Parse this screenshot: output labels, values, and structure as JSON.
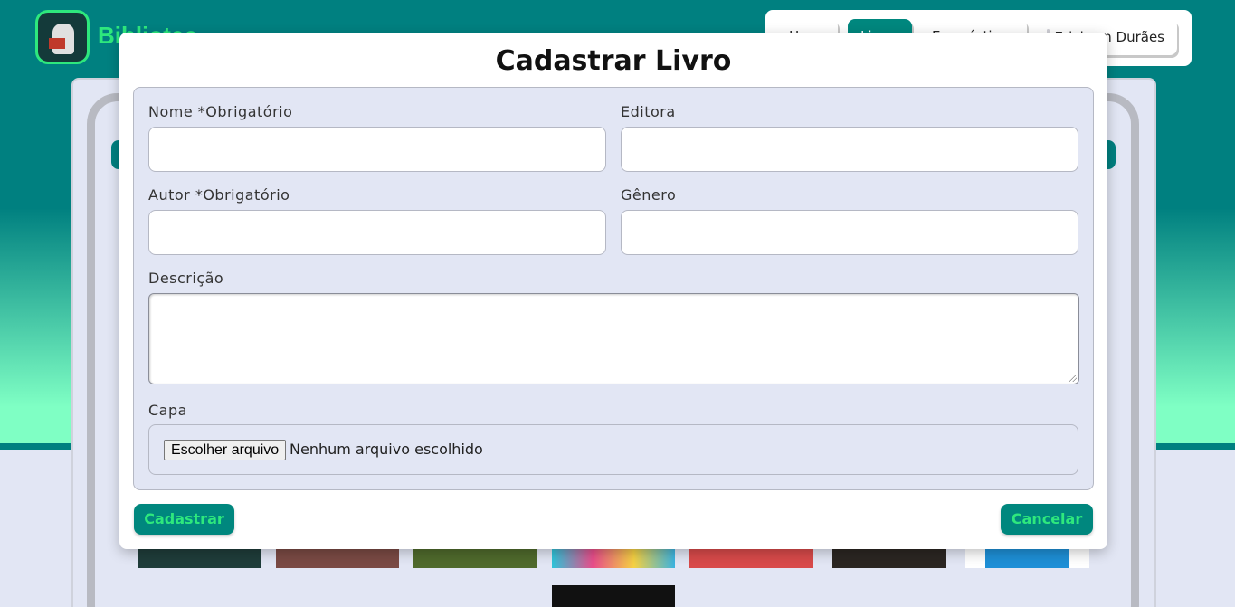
{
  "header": {
    "brand": "Bibliotec",
    "nav": [
      {
        "label": "Home"
      },
      {
        "label": "Livros"
      },
      {
        "label": "Empréstimos"
      }
    ],
    "user_name": "Erickson Durães"
  },
  "modal": {
    "title": "Cadastrar Livro",
    "fields": {
      "nome": {
        "label": "Nome *Obrigatório",
        "value": ""
      },
      "editora": {
        "label": "Editora",
        "value": ""
      },
      "autor": {
        "label": "Autor *Obrigatório",
        "value": ""
      },
      "genero": {
        "label": "Gênero",
        "value": ""
      },
      "descricao": {
        "label": "Descrição",
        "value": ""
      },
      "capa": {
        "label": "Capa",
        "button": "Escolher arquivo",
        "status": "Nenhum arquivo escolhido"
      }
    },
    "submit_label": "Cadastrar",
    "cancel_label": "Cancelar"
  },
  "colors": {
    "primary": "#00877e",
    "accent": "#2ee87d",
    "panel": "#e2e6f4",
    "gradient_bottom": "#7fffc4"
  }
}
